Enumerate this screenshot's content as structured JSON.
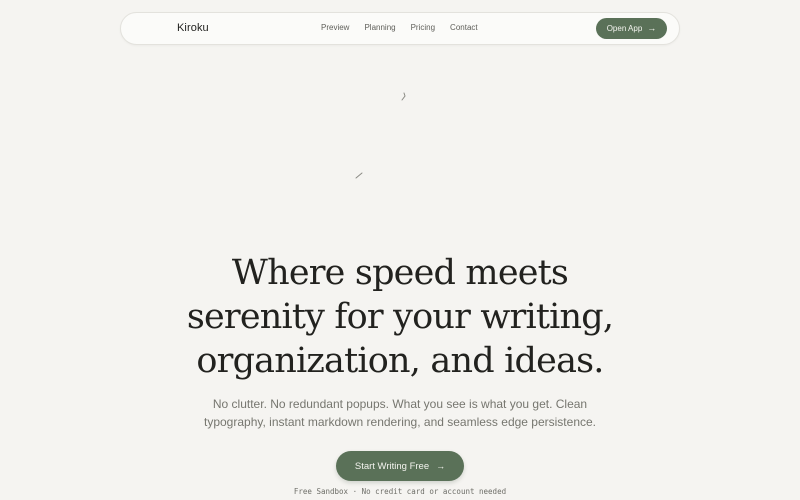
{
  "nav": {
    "brand": "Kiroku",
    "links": [
      "Preview",
      "Planning",
      "Pricing",
      "Contact"
    ],
    "open_app_label": "Open App"
  },
  "hero": {
    "title_lines": [
      "Where speed meets",
      "serenity for your writing,",
      "organization, and ideas."
    ],
    "subtitle_lines": [
      "No clutter. No redundant popups. What you see is what you get. Clean",
      "typography, instant markdown rendering, and seamless edge persistence."
    ],
    "cta_label": "Start Writing Free",
    "footnote": "Free Sandbox · No credit card or account needed"
  },
  "icons": {
    "arrow": "arrow-right-icon"
  },
  "colors": {
    "accent": "#5a7158",
    "background": "#f5f4f1"
  }
}
